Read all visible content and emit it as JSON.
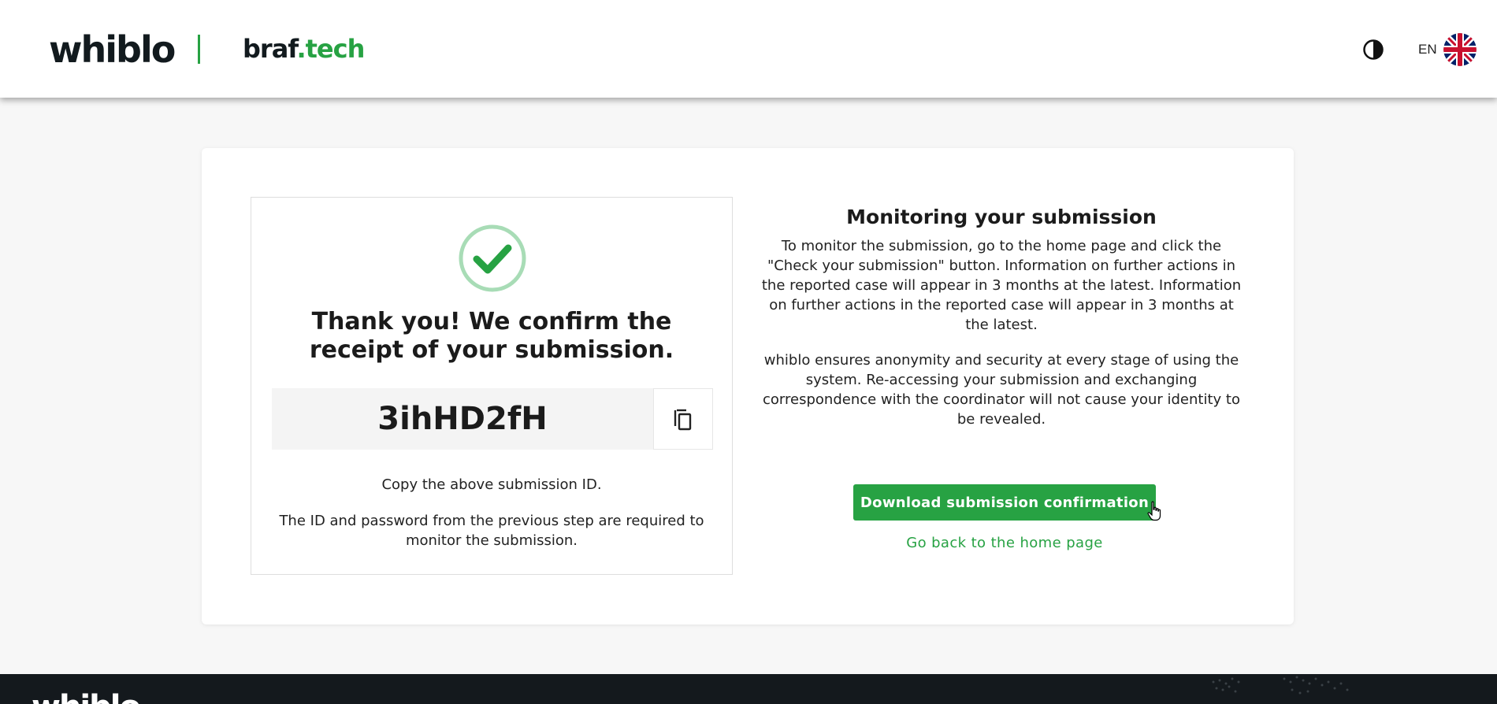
{
  "header": {
    "logo_whiblo": "whiblo",
    "logo_brand_part1": "braf",
    "logo_brand_part2": ".tech",
    "theme_toggle_icon": "contrast-icon",
    "language_code": "EN",
    "language_flag_icon": "uk-flag-icon"
  },
  "confirmation": {
    "icon": "check-circle-icon",
    "heading": "Thank you! We confirm the receipt of your submission.",
    "submission_id": "3ihHD2fH",
    "copy_icon": "copy-icon",
    "copy_note": "Copy the above submission ID.",
    "requirement_note": "The ID and password from the previous step are required to monitor the submission."
  },
  "monitoring": {
    "title": "Monitoring your submission",
    "paragraph1": "To monitor the submission, go to the home page and click the \"Check your submission\" button. Information on further actions in the reported case will appear in 3 months at the latest. Information on further actions in the reported case will appear in 3 months at the latest.",
    "paragraph2": "whiblo ensures anonymity and security at every stage of using the system. Re-accessing your submission and exchanging correspondence with the coordinator will not cause your identity to be revealed.",
    "download_button": "Download submission confirmation",
    "home_link": "Go back to the home page"
  },
  "footer": {
    "logo": "whiblo"
  },
  "colors": {
    "accent": "#27a243",
    "footer_bg": "#14191d",
    "page_bg": "#f7f7f7"
  }
}
